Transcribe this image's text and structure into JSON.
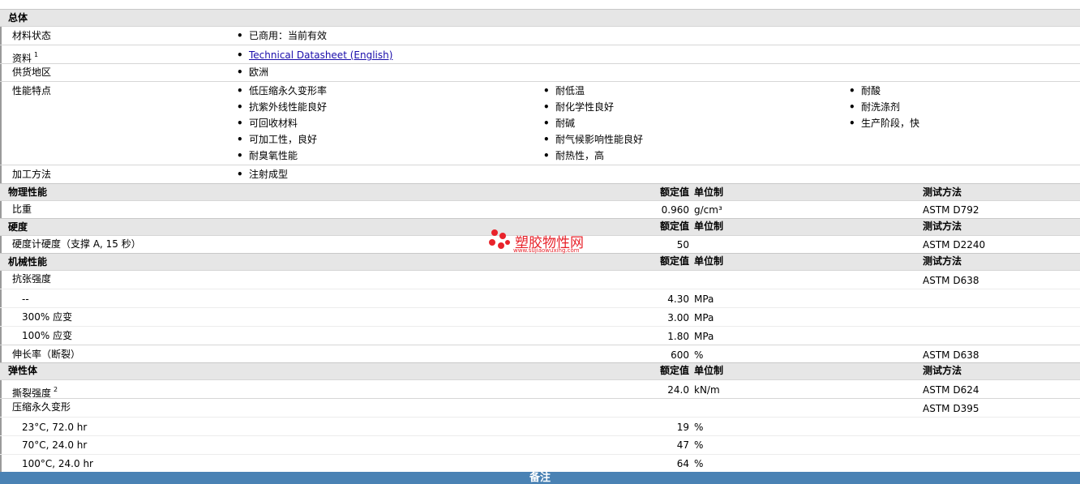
{
  "general": {
    "title": "总体",
    "material_status_label": "材料状态",
    "material_status_value": "已商用：当前有效",
    "documents_label": "资料",
    "documents_sup": "1",
    "documents_link": "Technical Datasheet (English)",
    "supply_label": "供货地区",
    "supply_value": "欧洲",
    "features_label": "性能特点",
    "features_col1": [
      "低压缩永久变形率",
      "抗紫外线性能良好",
      "可回收材料",
      "可加工性，良好",
      "耐臭氧性能"
    ],
    "features_col2": [
      "耐低温",
      "耐化学性良好",
      "耐碱",
      "耐气候影响性能良好",
      "耐热性，高"
    ],
    "features_col3": [
      "耐酸",
      "耐洗涤剂",
      "生产阶段，快"
    ],
    "processing_label": "加工方法",
    "processing_value": "注射成型"
  },
  "headers": {
    "nominal": "额定值",
    "unit": "单位制",
    "test": "测试方法"
  },
  "physical": {
    "title": "物理性能",
    "sg_label": "比重",
    "sg_value": "0.960",
    "sg_unit": "g/cm³",
    "sg_test": "ASTM D792"
  },
  "hardness": {
    "title": "硬度",
    "shore_label": "硬度计硬度（支撑 A, 15 秒）",
    "shore_value": "50",
    "shore_test": "ASTM D2240"
  },
  "mechanical": {
    "title": "机械性能",
    "tensile_label": "抗张强度",
    "tensile_test": "ASTM D638",
    "tensile_rows": [
      {
        "label": "--",
        "value": "4.30",
        "unit": "MPa"
      },
      {
        "label": "300% 应变",
        "value": "3.00",
        "unit": "MPa"
      },
      {
        "label": "100% 应变",
        "value": "1.80",
        "unit": "MPa"
      }
    ],
    "elong_label": "伸长率（断裂）",
    "elong_value": "600",
    "elong_unit": "%",
    "elong_test": "ASTM D638"
  },
  "elastomer": {
    "title": "弹性体",
    "tear_label": "撕裂强度",
    "tear_sup": "2",
    "tear_value": "24.0",
    "tear_unit": "kN/m",
    "tear_test": "ASTM D624",
    "cs_label": "压缩永久变形",
    "cs_test": "ASTM D395",
    "cs_rows": [
      {
        "label": "23°C, 72.0 hr",
        "value": "19",
        "unit": "%"
      },
      {
        "label": "70°C, 24.0 hr",
        "value": "47",
        "unit": "%"
      },
      {
        "label": "100°C, 24.0 hr",
        "value": "64",
        "unit": "%"
      }
    ]
  },
  "footer": {
    "notes": "备注"
  },
  "watermark": {
    "name": "塑胶物性网",
    "url": "www.sujiaowuxing.com"
  }
}
